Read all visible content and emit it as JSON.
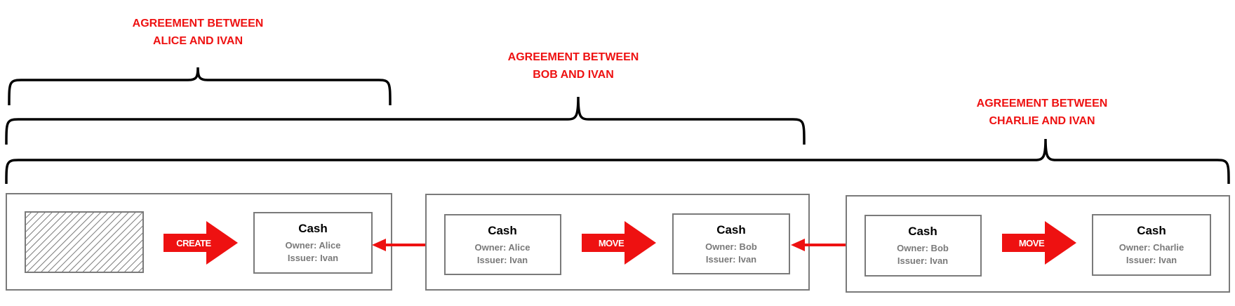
{
  "colors": {
    "accent": "#ee1111",
    "box_border": "#7a7a7a",
    "bracket": "#000000",
    "hatch": "#7a7a7a"
  },
  "agreements": [
    {
      "line1": "AGREEMENT BETWEEN",
      "line2": "ALICE AND IVAN"
    },
    {
      "line1": "AGREEMENT BETWEEN",
      "line2": "BOB AND IVAN"
    },
    {
      "line1": "AGREEMENT BETWEEN",
      "line2": "CHARLIE AND IVAN"
    }
  ],
  "transactions": [
    {
      "input": {
        "empty": true
      },
      "command": "CREATE",
      "output": {
        "title": "Cash",
        "owner": "Owner: Alice",
        "issuer": "Issuer: Ivan"
      }
    },
    {
      "input": {
        "title": "Cash",
        "owner": "Owner: Alice",
        "issuer": "Issuer: Ivan"
      },
      "command": "MOVE",
      "output": {
        "title": "Cash",
        "owner": "Owner: Bob",
        "issuer": "Issuer: Ivan"
      }
    },
    {
      "input": {
        "title": "Cash",
        "owner": "Owner: Bob",
        "issuer": "Issuer: Ivan"
      },
      "command": "MOVE",
      "output": {
        "title": "Cash",
        "owner": "Owner: Charlie",
        "issuer": "Issuer: Ivan"
      }
    }
  ]
}
